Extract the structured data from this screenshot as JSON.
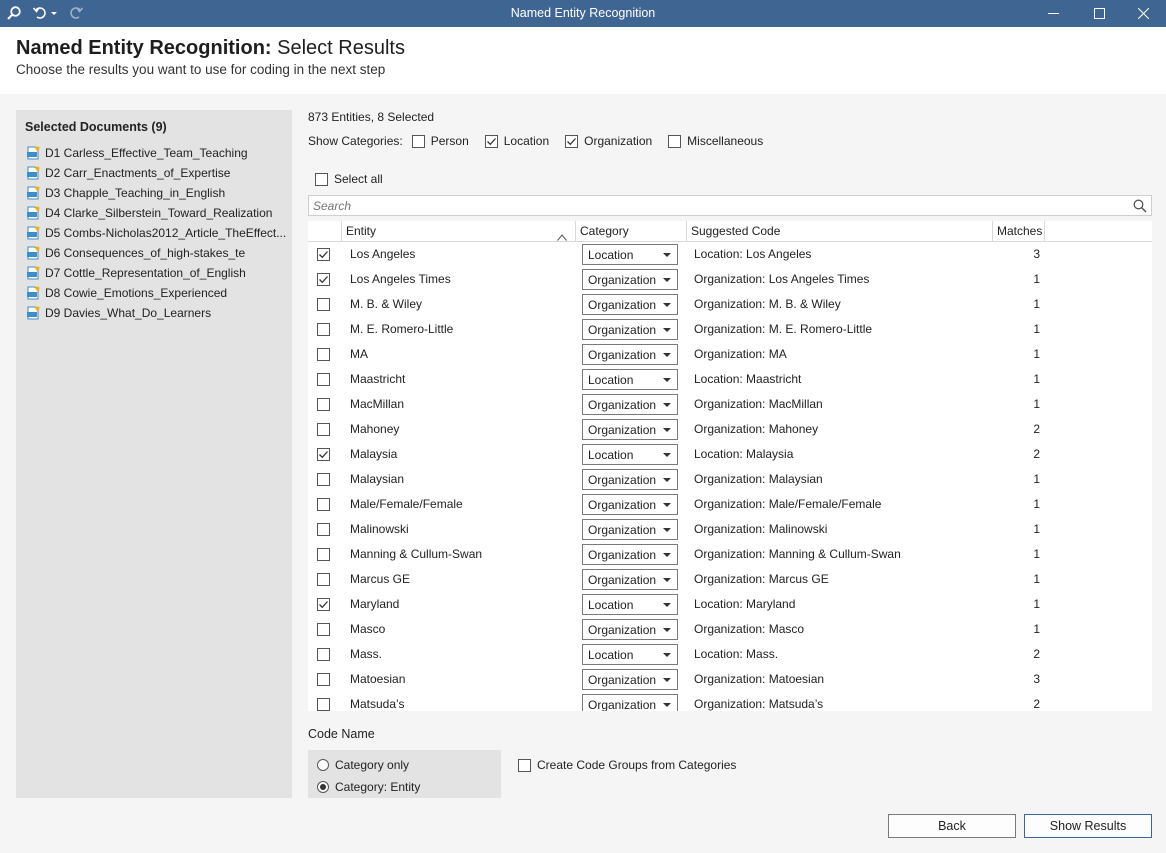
{
  "window": {
    "title": "Named Entity Recognition"
  },
  "header": {
    "title_bold": "Named Entity Recognition:",
    "title_rest": " Select Results",
    "subtitle": "Choose the results you want to use for coding in the next step"
  },
  "documents": {
    "title": "Selected Documents (9)",
    "items": [
      "D1 Carless_Effective_Team_Teaching",
      "D2 Carr_Enactments_of_Expertise",
      "D3 Chapple_Teaching_in_English",
      "D4 Clarke_Silberstein_Toward_Realization",
      "D5 Combs-Nicholas2012_Article_TheEffect...",
      "D6 Consequences_of_high-stakes_te",
      "D7 Cottle_Representation_of_English",
      "D8 Cowie_Emotions_Experienced",
      "D9 Davies_What_Do_Learners"
    ]
  },
  "summary": "873 Entities, 8 Selected",
  "categories": {
    "label": "Show Categories:",
    "items": [
      {
        "label": "Person",
        "checked": false
      },
      {
        "label": "Location",
        "checked": true
      },
      {
        "label": "Organization",
        "checked": true
      },
      {
        "label": "Miscellaneous",
        "checked": false
      }
    ]
  },
  "select_all": "Select all",
  "search": {
    "placeholder": "Search"
  },
  "table": {
    "headers": [
      "Entity",
      "Category",
      "Suggested Code",
      "Matches"
    ],
    "rows": [
      {
        "checked": true,
        "entity": "Los Angeles",
        "category": "Location",
        "code": "Location: Los Angeles",
        "matches": "3"
      },
      {
        "checked": true,
        "entity": "Los Angeles Times",
        "category": "Organization",
        "code": "Organization: Los Angeles Times",
        "matches": "1"
      },
      {
        "checked": false,
        "entity": "M. B. & Wiley",
        "category": "Organization",
        "code": "Organization: M. B. & Wiley",
        "matches": "1"
      },
      {
        "checked": false,
        "entity": "M. E. Romero-Little",
        "category": "Organization",
        "code": "Organization: M. E. Romero-Little",
        "matches": "1"
      },
      {
        "checked": false,
        "entity": "MA",
        "category": "Organization",
        "code": "Organization: MA",
        "matches": "1"
      },
      {
        "checked": false,
        "entity": "Maastricht",
        "category": "Location",
        "code": "Location: Maastricht",
        "matches": "1"
      },
      {
        "checked": false,
        "entity": "MacMillan",
        "category": "Organization",
        "code": "Organization: MacMillan",
        "matches": "1"
      },
      {
        "checked": false,
        "entity": "Mahoney",
        "category": "Organization",
        "code": "Organization: Mahoney",
        "matches": "2"
      },
      {
        "checked": true,
        "entity": "Malaysia",
        "category": "Location",
        "code": "Location: Malaysia",
        "matches": "2"
      },
      {
        "checked": false,
        "entity": "Malaysian",
        "category": "Organization",
        "code": "Organization: Malaysian",
        "matches": "1"
      },
      {
        "checked": false,
        "entity": "Male/Female/Female",
        "category": "Organization",
        "code": "Organization: Male/Female/Female",
        "matches": "1"
      },
      {
        "checked": false,
        "entity": "Malinowski",
        "category": "Organization",
        "code": "Organization: Malinowski",
        "matches": "1"
      },
      {
        "checked": false,
        "entity": "Manning & Cullum-Swan",
        "category": "Organization",
        "code": "Organization: Manning & Cullum-Swan",
        "matches": "1"
      },
      {
        "checked": false,
        "entity": "Marcus GE",
        "category": "Organization",
        "code": "Organization: Marcus GE",
        "matches": "1"
      },
      {
        "checked": true,
        "entity": "Maryland",
        "category": "Location",
        "code": "Location: Maryland",
        "matches": "1"
      },
      {
        "checked": false,
        "entity": "Masco",
        "category": "Organization",
        "code": "Organization: Masco",
        "matches": "1"
      },
      {
        "checked": false,
        "entity": "Mass.",
        "category": "Location",
        "code": "Location: Mass.",
        "matches": "2"
      },
      {
        "checked": false,
        "entity": "Matoesian",
        "category": "Organization",
        "code": "Organization: Matoesian",
        "matches": "3"
      },
      {
        "checked": false,
        "entity": "Matsuda’s",
        "category": "Organization",
        "code": "Organization: Matsuda’s",
        "matches": "2"
      }
    ]
  },
  "code_name": {
    "label": "Code Name",
    "options": [
      {
        "label": "Category only",
        "selected": false
      },
      {
        "label": "Category: Entity",
        "selected": true
      }
    ]
  },
  "create_groups": {
    "label": "Create Code Groups from Categories",
    "checked": false
  },
  "buttons": {
    "back": "Back",
    "show_results": "Show Results"
  },
  "colors": {
    "titlebar": "#3f6692",
    "panel": "#e3e3e3",
    "background": "#f5f5f5"
  },
  "icons": [
    "search-icon",
    "undo-icon",
    "redo-icon",
    "minimize-icon",
    "maximize-icon",
    "close-icon",
    "pdf-icon",
    "checkmark-icon",
    "sort-up-icon",
    "dropdown-arrow-icon"
  ]
}
